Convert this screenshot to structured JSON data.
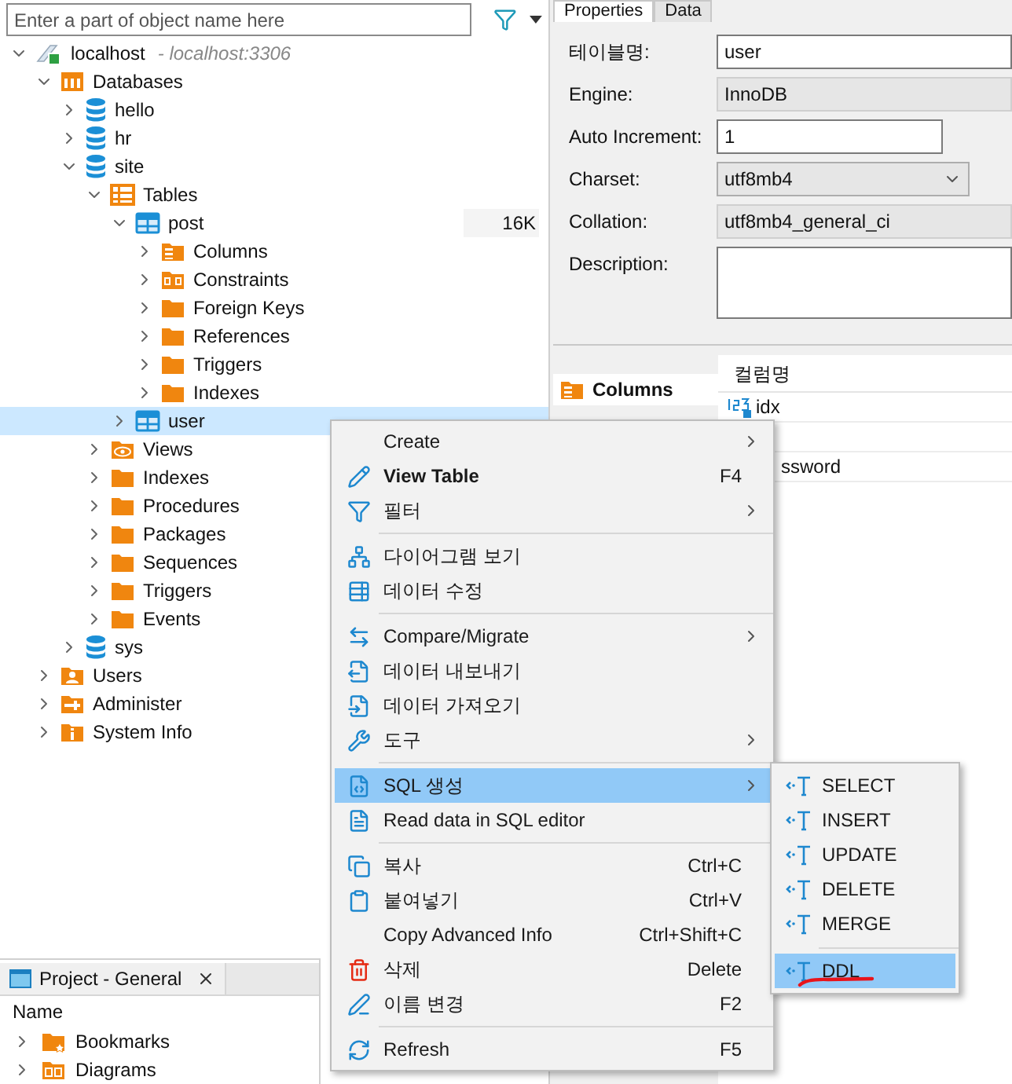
{
  "navigator": {
    "search": {
      "placeholder": "Enter a part of object name here"
    },
    "tree": [
      {
        "kind": "connection",
        "label": "localhost",
        "note": "- localhost:3306",
        "expanded": true,
        "selected": false,
        "children": [
          {
            "kind": "databases",
            "label": "Databases",
            "expanded": true,
            "selected": false,
            "children": [
              {
                "kind": "database",
                "label": "hello",
                "expanded": false,
                "selected": false
              },
              {
                "kind": "database",
                "label": "hr",
                "expanded": false,
                "selected": false
              },
              {
                "kind": "database",
                "label": "site",
                "expanded": true,
                "selected": false,
                "children": [
                  {
                    "kind": "tables",
                    "label": "Tables",
                    "expanded": true,
                    "selected": false,
                    "children": [
                      {
                        "kind": "table",
                        "label": "post",
                        "size": "16K",
                        "expanded": true,
                        "selected": false,
                        "children": [
                          {
                            "kind": "columns",
                            "label": "Columns",
                            "expanded": false,
                            "selected": false
                          },
                          {
                            "kind": "constraints",
                            "label": "Constraints",
                            "expanded": false,
                            "selected": false
                          },
                          {
                            "kind": "folder",
                            "label": "Foreign Keys",
                            "expanded": false,
                            "selected": false
                          },
                          {
                            "kind": "folder",
                            "label": "References",
                            "expanded": false,
                            "selected": false
                          },
                          {
                            "kind": "folder",
                            "label": "Triggers",
                            "expanded": false,
                            "selected": false
                          },
                          {
                            "kind": "folder",
                            "label": "Indexes",
                            "expanded": false,
                            "selected": false
                          }
                        ]
                      },
                      {
                        "kind": "table",
                        "label": "user",
                        "expanded": false,
                        "selected": true
                      }
                    ]
                  },
                  {
                    "kind": "views",
                    "label": "Views",
                    "expanded": false,
                    "selected": false
                  },
                  {
                    "kind": "folder",
                    "label": "Indexes",
                    "expanded": false,
                    "selected": false
                  },
                  {
                    "kind": "folder",
                    "label": "Procedures",
                    "expanded": false,
                    "selected": false
                  },
                  {
                    "kind": "folder",
                    "label": "Packages",
                    "expanded": false,
                    "selected": false
                  },
                  {
                    "kind": "folder",
                    "label": "Sequences",
                    "expanded": false,
                    "selected": false
                  },
                  {
                    "kind": "folder",
                    "label": "Triggers",
                    "expanded": false,
                    "selected": false
                  },
                  {
                    "kind": "folder",
                    "label": "Events",
                    "expanded": false,
                    "selected": false
                  }
                ]
              },
              {
                "kind": "database",
                "label": "sys",
                "expanded": false,
                "selected": false
              }
            ]
          },
          {
            "kind": "users",
            "label": "Users",
            "expanded": false,
            "selected": false
          },
          {
            "kind": "admin",
            "label": "Administer",
            "expanded": false,
            "selected": false
          },
          {
            "kind": "info",
            "label": "System Info",
            "expanded": false,
            "selected": false
          }
        ]
      }
    ]
  },
  "project": {
    "title": "Project - General",
    "header": "Name",
    "items": [
      {
        "kind": "bookmarks",
        "label": "Bookmarks"
      },
      {
        "kind": "diagrams",
        "label": "Diagrams"
      }
    ]
  },
  "editor": {
    "tabs": [
      {
        "label": "Properties",
        "selected": true
      },
      {
        "label": "Data",
        "selected": false
      }
    ],
    "fields": [
      {
        "kind": "input",
        "label": "테이블명:",
        "value": "user"
      },
      {
        "kind": "readonly",
        "label": "Engine:",
        "value": "InnoDB"
      },
      {
        "kind": "short",
        "label": "Auto Increment:",
        "value": "1"
      },
      {
        "kind": "select",
        "label": "Charset:",
        "value": "utf8mb4"
      },
      {
        "kind": "readonly",
        "label": "Collation:",
        "value": "utf8mb4_general_ci"
      },
      {
        "kind": "textarea",
        "label": "Description:"
      }
    ],
    "sections": [
      {
        "label": "Columns",
        "selected": true
      }
    ],
    "columns_header": "컬럼명",
    "rows": [
      {
        "kind": "number",
        "name": "idx"
      },
      {
        "kind": "blank"
      },
      {
        "kind": "text",
        "name": "ssword"
      }
    ]
  },
  "context_menu": {
    "items": [
      {
        "kind": "item",
        "label": "Create",
        "submenu": true,
        "bold": false,
        "selected": false
      },
      {
        "kind": "item",
        "label": "View Table",
        "shortcut": "F4",
        "submenu": false,
        "bold": true,
        "selected": false
      },
      {
        "kind": "item",
        "label": "필터",
        "submenu": true,
        "bold": false,
        "selected": false
      },
      {
        "kind": "separator"
      },
      {
        "kind": "item",
        "label": "다이어그램 보기",
        "submenu": false,
        "bold": false,
        "selected": false
      },
      {
        "kind": "item",
        "label": "데이터 수정",
        "submenu": false,
        "bold": false,
        "selected": false
      },
      {
        "kind": "separator"
      },
      {
        "kind": "item",
        "label": "Compare/Migrate",
        "submenu": true,
        "bold": false,
        "selected": false
      },
      {
        "kind": "item",
        "label": "데이터 내보내기",
        "submenu": false,
        "bold": false,
        "selected": false
      },
      {
        "kind": "item",
        "label": "데이터 가져오기",
        "submenu": false,
        "bold": false,
        "selected": false
      },
      {
        "kind": "item",
        "label": "도구",
        "submenu": true,
        "bold": false,
        "selected": false
      },
      {
        "kind": "separator"
      },
      {
        "kind": "item",
        "label": "SQL 생성",
        "submenu": true,
        "bold": false,
        "selected": true
      },
      {
        "kind": "item",
        "label": "Read data in SQL editor",
        "submenu": false,
        "bold": false,
        "selected": false
      },
      {
        "kind": "separator"
      },
      {
        "kind": "item",
        "label": "복사",
        "shortcut": "Ctrl+C",
        "submenu": false,
        "bold": false,
        "selected": false
      },
      {
        "kind": "item",
        "label": "붙여넣기",
        "shortcut": "Ctrl+V",
        "submenu": false,
        "bold": false,
        "selected": false
      },
      {
        "kind": "item",
        "label": "Copy Advanced Info",
        "shortcut": "Ctrl+Shift+C",
        "submenu": false,
        "bold": false,
        "selected": false
      },
      {
        "kind": "item",
        "label": "삭제",
        "shortcut": "Delete",
        "submenu": false,
        "bold": false,
        "selected": false
      },
      {
        "kind": "item",
        "label": "이름 변경",
        "shortcut": "F2",
        "submenu": false,
        "bold": false,
        "selected": false
      },
      {
        "kind": "separator"
      },
      {
        "kind": "item",
        "label": "Refresh",
        "shortcut": "F5",
        "submenu": false,
        "bold": false,
        "selected": false
      }
    ],
    "submenu": [
      {
        "kind": "item",
        "label": "SELECT",
        "selected": false
      },
      {
        "kind": "item",
        "label": "INSERT",
        "selected": false
      },
      {
        "kind": "item",
        "label": "UPDATE",
        "selected": false
      },
      {
        "kind": "item",
        "label": "DELETE",
        "selected": false
      },
      {
        "kind": "item",
        "label": "MERGE",
        "selected": false
      },
      {
        "kind": "separator"
      },
      {
        "kind": "item",
        "label": "DDL",
        "selected": true,
        "underlined": true
      }
    ]
  }
}
